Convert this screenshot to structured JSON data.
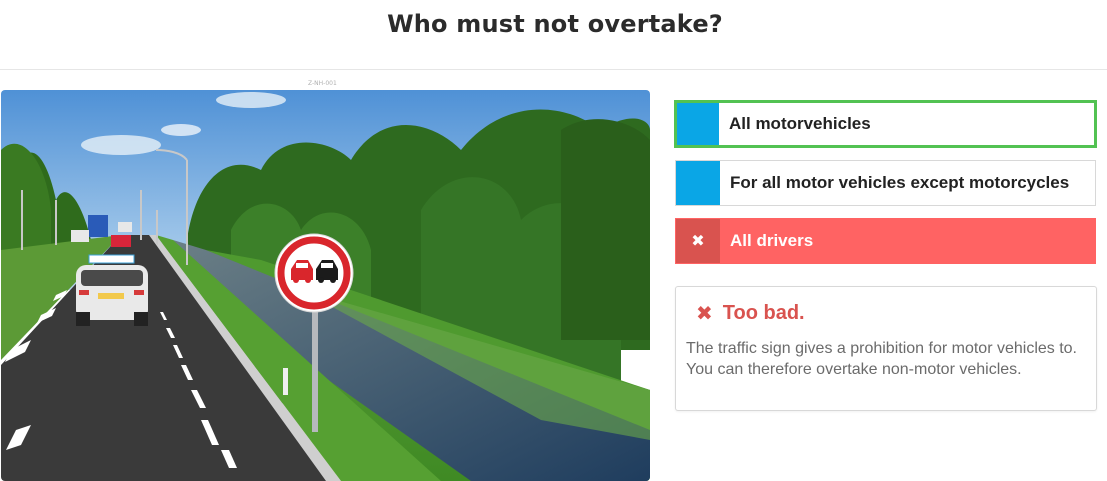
{
  "question": {
    "title": "Who must not overtake?"
  },
  "image": {
    "code": "Z-NH-001",
    "alt": "Road with traffic sign"
  },
  "answers": [
    {
      "label": "All motorvehicles",
      "state": "selected",
      "marker": ""
    },
    {
      "label": "For all motor vehicles except motorcycles",
      "state": "default",
      "marker": ""
    },
    {
      "label": "All drivers",
      "state": "wrong",
      "marker": "✖"
    }
  ],
  "feedback": {
    "icon": "close-icon",
    "title": "Too bad.",
    "text": "The traffic sign gives a prohibition for motor vehicles to. You can therefore overtake non-motor vehicles."
  },
  "colors": {
    "accent": "#0aa6e6",
    "selected_border": "#52c252",
    "wrong_bg": "#ff6363",
    "error": "#d9534f"
  }
}
